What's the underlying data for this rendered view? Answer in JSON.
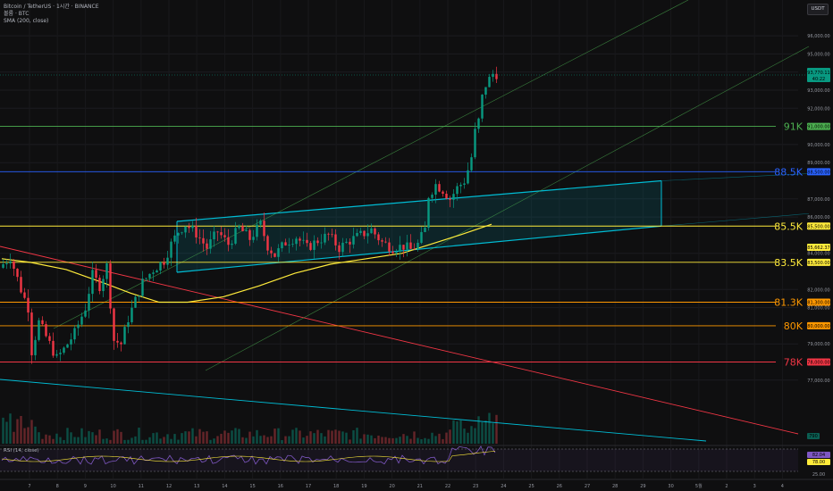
{
  "legend": {
    "title": "Bitcoin / TetherUS · 1시간 · BINANCE",
    "volume": "볼륨 · BTC",
    "sma": "SMA (200, close)",
    "rsi": "RSI (14, close)",
    "currency": "USDT"
  },
  "chart_data": {
    "type": "candlestick",
    "symbol": "Bitcoin / TetherUS",
    "interval": "1시간",
    "exchange": "BINANCE",
    "ylim": [
      76000,
      97300
    ],
    "y_ticks": [
      "96,000.00",
      "95,000.00",
      "94,000.00",
      "93,000.00",
      "92,000.00",
      "90,000.00",
      "89,000.00",
      "87,000.00",
      "86,000.00",
      "84,000.00",
      "82,000.00",
      "81,000.00",
      "79,000.00",
      "77,000.00"
    ],
    "x_ticks": [
      "7",
      "8",
      "9",
      "10",
      "11",
      "12",
      "13",
      "14",
      "15",
      "16",
      "17",
      "18",
      "19",
      "20",
      "21",
      "22",
      "23",
      "24",
      "25",
      "26",
      "27",
      "28",
      "29",
      "30",
      "5월",
      "2",
      "3",
      "4"
    ],
    "price_path": [
      [
        0,
        83200
      ],
      [
        3,
        83800
      ],
      [
        6,
        82000
      ],
      [
        8,
        81000
      ],
      [
        9,
        78600
      ],
      [
        11,
        80200
      ],
      [
        13,
        79400
      ],
      [
        16,
        78200
      ],
      [
        18,
        78700
      ],
      [
        21,
        79600
      ],
      [
        24,
        81000
      ],
      [
        26,
        82800
      ],
      [
        28,
        82200
      ],
      [
        30,
        83300
      ],
      [
        32,
        79200
      ],
      [
        34,
        79000
      ],
      [
        36,
        80400
      ],
      [
        38,
        81400
      ],
      [
        40,
        82400
      ],
      [
        43,
        83100
      ],
      [
        46,
        83600
      ],
      [
        48,
        84500
      ],
      [
        50,
        85200
      ],
      [
        52,
        85600
      ],
      [
        55,
        85100
      ],
      [
        58,
        84300
      ],
      [
        61,
        85200
      ],
      [
        64,
        84500
      ],
      [
        67,
        85400
      ],
      [
        70,
        84800
      ],
      [
        73,
        85600
      ],
      [
        75,
        84400
      ],
      [
        77,
        83900
      ],
      [
        80,
        84600
      ],
      [
        83,
        84900
      ],
      [
        86,
        84300
      ],
      [
        89,
        84700
      ],
      [
        92,
        85000
      ],
      [
        95,
        84300
      ],
      [
        98,
        84700
      ],
      [
        101,
        85000
      ],
      [
        104,
        85300
      ],
      [
        107,
        84600
      ],
      [
        110,
        84300
      ],
      [
        113,
        84400
      ],
      [
        115,
        84200
      ],
      [
        117,
        84500
      ],
      [
        119,
        85300
      ],
      [
        120,
        87200
      ],
      [
        122,
        87800
      ],
      [
        124,
        87500
      ],
      [
        126,
        87000
      ],
      [
        128,
        87600
      ],
      [
        130,
        88000
      ],
      [
        131,
        88600
      ],
      [
        132,
        89300
      ],
      [
        133,
        90700
      ],
      [
        134,
        91300
      ],
      [
        135,
        92600
      ],
      [
        136,
        93300
      ],
      [
        137,
        93600
      ],
      [
        138,
        93900
      ]
    ],
    "levels": [
      {
        "label": "91K",
        "price": 91000,
        "price_label": "91,000.00",
        "color": "#4caf50"
      },
      {
        "label": "88.5K",
        "price": 88500,
        "price_label": "88,500.00",
        "color": "#2962ff"
      },
      {
        "label": "85.5K",
        "price": 85500,
        "price_label": "85,500.00",
        "color": "#ffeb3b"
      },
      {
        "label": "83.5K",
        "price": 83500,
        "price_label": "83,500.00",
        "color": "#ffeb3b"
      },
      {
        "label": "81.3K",
        "price": 81300,
        "price_label": "81,300.00",
        "color": "#ff9800"
      },
      {
        "label": "80K",
        "price": 80000,
        "price_label": "80,000.00",
        "color": "#ff9800"
      },
      {
        "label": "78K",
        "price": 78000,
        "price_label": "78,000.00",
        "color": "#f23645"
      }
    ],
    "current_price": {
      "label": "93,770.11",
      "countdown": "40:22",
      "color": "#089981"
    },
    "sma_value": {
      "label": "85,662.37",
      "color": "#ffeb3b"
    },
    "rsi_value": {
      "label": "82.04",
      "color": "#7e57c2"
    },
    "rsi_level": {
      "label": "78.00",
      "color": "#ffeb3b"
    },
    "rsi_ticks": [
      "25.00"
    ],
    "volume_badge": "790",
    "colors": {
      "up": "#089981",
      "down": "#f23645",
      "sma": "#ffeb3b",
      "channel": "#00bcd4",
      "trend_red": "#f23645",
      "trend_blue": "#00bcd4",
      "trend_green": "#4caf50"
    }
  }
}
